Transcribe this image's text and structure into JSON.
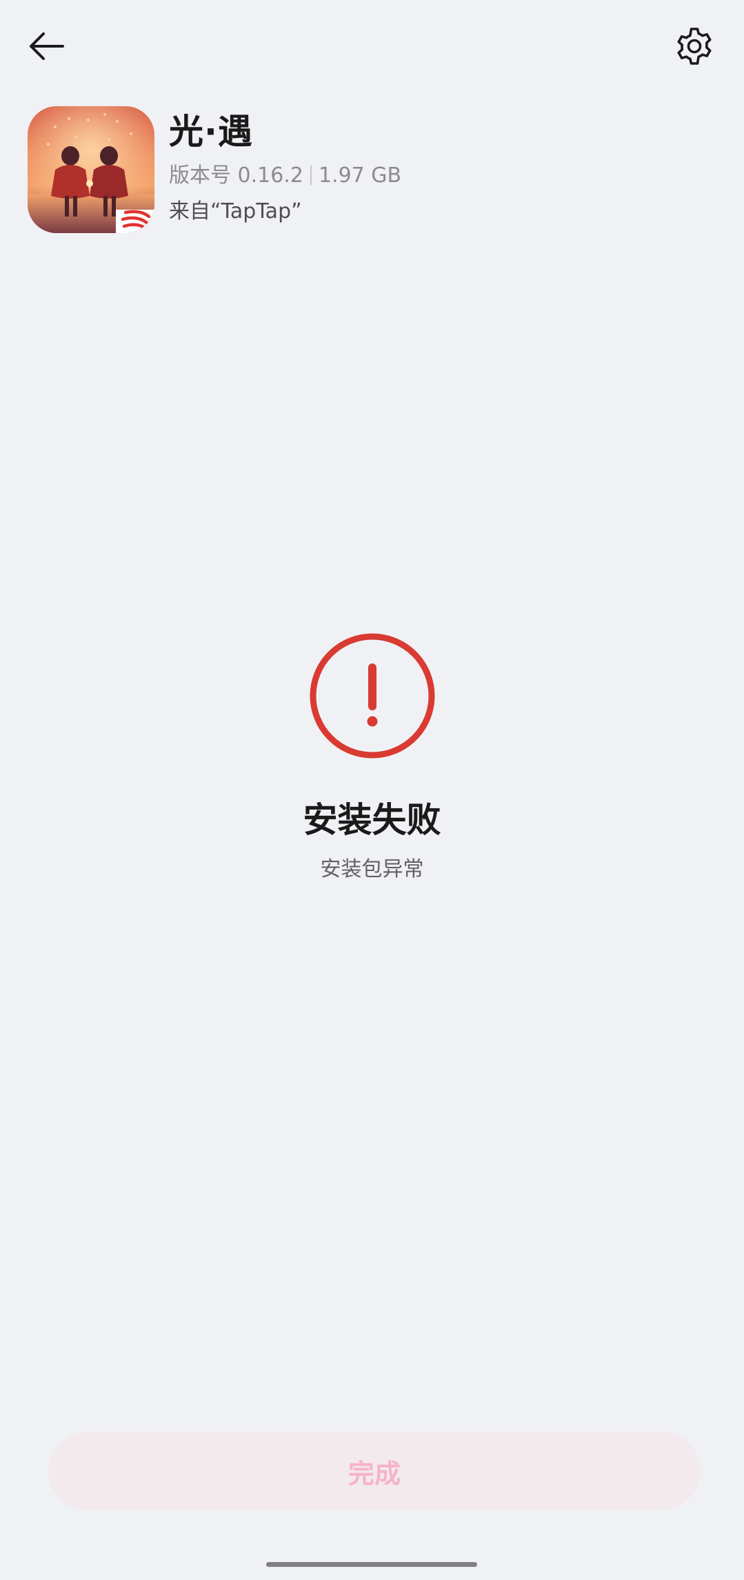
{
  "app": {
    "name": "光·遇",
    "version": "版本号 0.16.2",
    "size": "1.97 GB",
    "source": "来自“TapTap”"
  },
  "status": {
    "title": "安装失败",
    "description": "安装包异常",
    "color": "#d93a32"
  },
  "actions": {
    "done_label": "完成"
  },
  "icons": {
    "back": "arrow-left-icon",
    "settings": "gear-icon",
    "error": "exclamation-circle-icon"
  }
}
